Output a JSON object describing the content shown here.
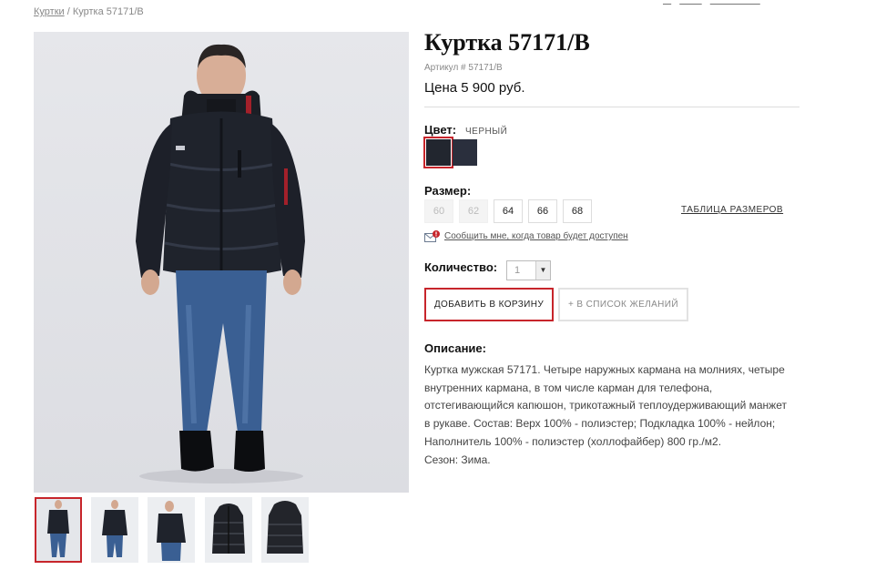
{
  "breadcrumb": {
    "parent": "Куртки",
    "separator": "/",
    "current": "Куртка 57171/B"
  },
  "product": {
    "title": "Куртка 57171/В",
    "sku": "Артикул # 57171/В",
    "price": "Цена 5 900 руб."
  },
  "color": {
    "label": "Цвет:",
    "value": "ЧЕРНЫЙ",
    "swatches": [
      {
        "name": "черный",
        "hex": "#22262f",
        "selected": true
      },
      {
        "name": "темно-синий",
        "hex": "#2a2f3d",
        "selected": false
      }
    ]
  },
  "size": {
    "label": "Размер:",
    "options": [
      {
        "value": "60",
        "available": false
      },
      {
        "value": "62",
        "available": false
      },
      {
        "value": "64",
        "available": true
      },
      {
        "value": "66",
        "available": true
      },
      {
        "value": "68",
        "available": true
      }
    ],
    "table_link": "ТАБЛИЦА РАЗМЕРОВ"
  },
  "notify": {
    "text": "Сообщить мне, когда товар будет доступен",
    "icon": "mail-alert-icon"
  },
  "quantity": {
    "label": "Количество:",
    "value": "1"
  },
  "buttons": {
    "cart": "ДОБАВИТЬ В КОРЗИНУ",
    "wishlist": "+ В СПИСОК ЖЕЛАНИЙ"
  },
  "description": {
    "title": "Описание:",
    "lines": [
      "Куртка мужская 57171. Четыре наружных кармана на молниях, четыре",
      "внутренних кармана, в том числе карман для телефона,",
      "отстегивающийся капюшон, трикотажный теплоудерживающий манжет",
      "в рукаве. Состав: Верх 100% - полиэстер; Подкладка 100% - нейлон;",
      "Наполнитель 100% - полиэстер (холлофайбер) 800 гр./м2.",
      "Сезон: Зима."
    ]
  },
  "colors": {
    "accent": "#c7252b",
    "jacket": "#1f232c",
    "jeans": "#3a5f93"
  }
}
